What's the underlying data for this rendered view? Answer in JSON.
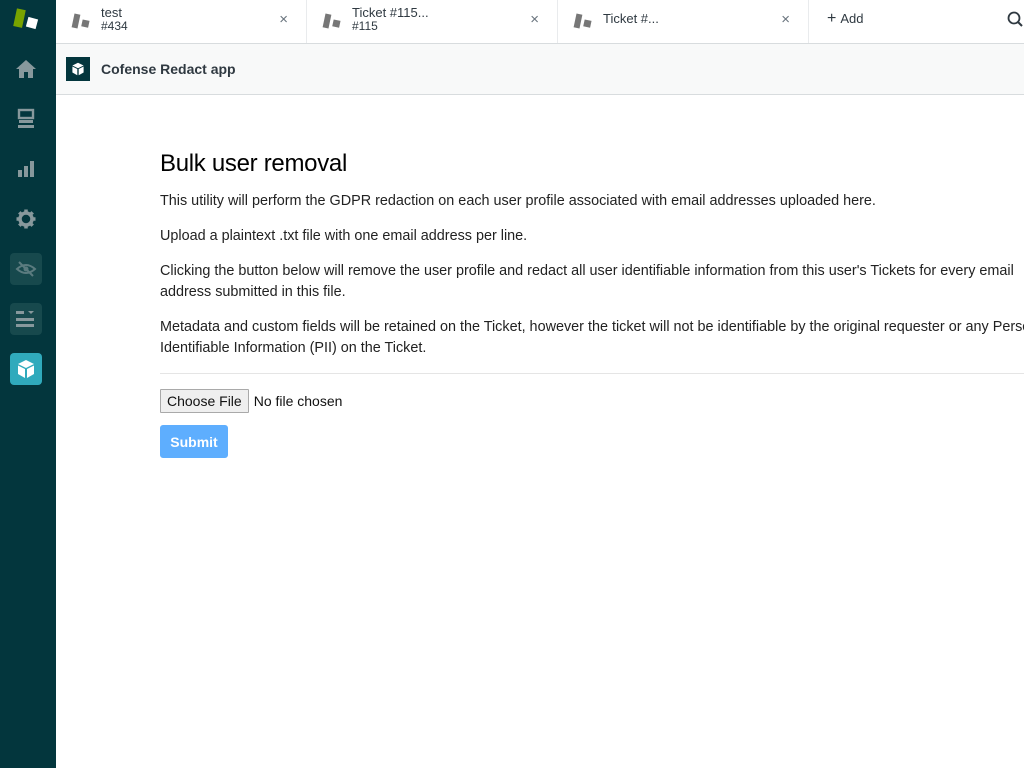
{
  "sidebar": {
    "logo": "zendesk-logo",
    "items": [
      {
        "name": "home",
        "icon": "home-icon"
      },
      {
        "name": "views",
        "icon": "inbox-icon"
      },
      {
        "name": "reporting",
        "icon": "bar-chart-icon"
      },
      {
        "name": "admin",
        "icon": "gear-icon"
      },
      {
        "name": "redaction-app",
        "icon": "eye-slash-icon"
      },
      {
        "name": "list-app",
        "icon": "list-icon"
      },
      {
        "name": "cofense-redact-app",
        "icon": "cube-icon",
        "active": true
      }
    ]
  },
  "tabs": [
    {
      "title": "test",
      "subtitle": "#434",
      "close": "×"
    },
    {
      "title": "Ticket #115...",
      "subtitle": "#115",
      "close": "×"
    },
    {
      "title": "Ticket #...",
      "subtitle": "",
      "close": "×"
    }
  ],
  "add_tab_label": "Add",
  "app_header": {
    "title": "Cofense Redact app"
  },
  "main": {
    "heading": "Bulk user removal",
    "paragraphs": [
      "This utility will perform the GDPR redaction on each user profile associated with email addresses uploaded here.",
      "Upload a plaintext .txt file with one email address per line.",
      "Clicking the button below will remove the user profile and redact all user identifiable information from this user's Tickets for every email address submitted in this file.",
      "Metadata and custom fields will be retained on the Ticket, however the ticket will not be identifiable by the original requester or any Personally Identifiable Information (PII) on the Ticket."
    ],
    "file_input": {
      "button_label": "Choose File",
      "status": "No file chosen"
    },
    "submit_label": "Submit"
  },
  "colors": {
    "sidebar_bg": "#03363d",
    "active_nav": "#30aabc",
    "submit_button": "#5eaefe",
    "logo_green": "#78a300"
  }
}
